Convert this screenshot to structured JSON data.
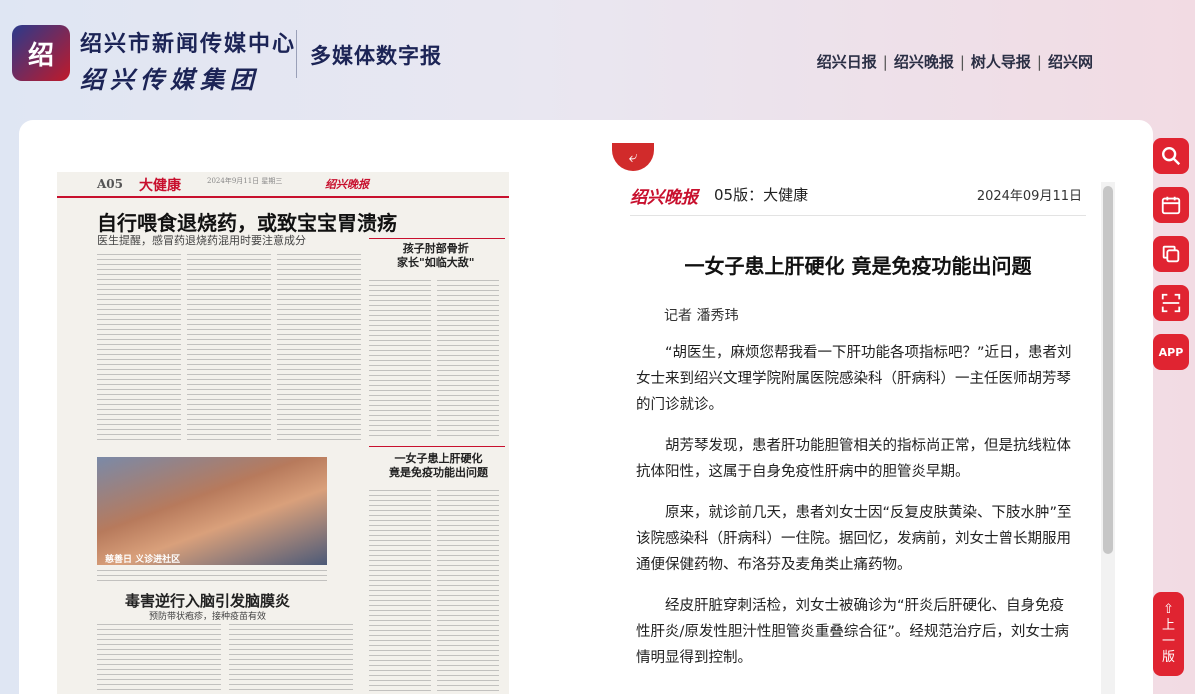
{
  "header": {
    "logo_badge": "绍",
    "logo_line1": "绍兴市新闻传媒中心",
    "logo_line2": "绍兴传媒集团",
    "subtitle": "多媒体数字报",
    "links": [
      "绍兴日报",
      "绍兴晚报",
      "树人导报",
      "绍兴网"
    ],
    "separator": "|"
  },
  "paper": {
    "page_no": "A05",
    "section": "大健康",
    "meta": "2024年9月11日 星期三",
    "masthead": "绍兴晚报",
    "headline": "自行喂食退烧药，或致宝宝胃溃疡",
    "headline_sub": "医生提醒，感冒药退烧药混用时要注意成分",
    "side_headline_1": "孩子肘部骨折\n家长\"如临大敌\"",
    "side_headline_2": "一女子患上肝硬化\n竟是免疫功能出问题",
    "photo_caption": "慈善日 义诊进社区",
    "bottom_headline": "毒害逆行入脑引发脑膜炎",
    "bottom_sub": "预防带状疱疹，接种疫苗有效"
  },
  "article": {
    "return_icon": "return-arrow-icon",
    "brand": "绍兴晚报",
    "edition": "05版：大健康",
    "date": "2024年09月11日",
    "title": "一女子患上肝硬化 竟是免疫功能出问题",
    "author": "记者 潘秀玮",
    "paragraphs": [
      "“胡医生，麻烦您帮我看一下肝功能各项指标吧？”近日，患者刘女士来到绍兴文理学院附属医院感染科（肝病科）一主任医师胡芳琴的门诊就诊。",
      "胡芳琴发现，患者肝功能胆管相关的指标尚正常，但是抗线粒体抗体阳性，这属于自身免疫性肝病中的胆管炎早期。",
      "原来，就诊前几天，患者刘女士因“反复皮肤黄染、下肢水肿”至该院感染科（肝病科）一住院。据回忆，发病前，刘女士曾长期服用通便保健药物、布洛芬及麦角类止痛药物。",
      "经皮肝脏穿刺活检，刘女士被确诊为“肝炎后肝硬化、自身免疫性肝炎/原发性胆汁性胆管炎重叠综合征”。经规范治疗后，刘女士病情明显得到控制。"
    ]
  },
  "toolbar": {
    "icons": [
      "search-icon",
      "calendar-icon",
      "copy-icon",
      "scan-icon"
    ],
    "app_label": "APP",
    "prev_label": [
      "上",
      "一",
      "版"
    ],
    "prev_arrow": "⇧"
  },
  "colors": {
    "accent": "#e02431",
    "brand_red": "#c8102e",
    "navy": "#1c2456"
  }
}
